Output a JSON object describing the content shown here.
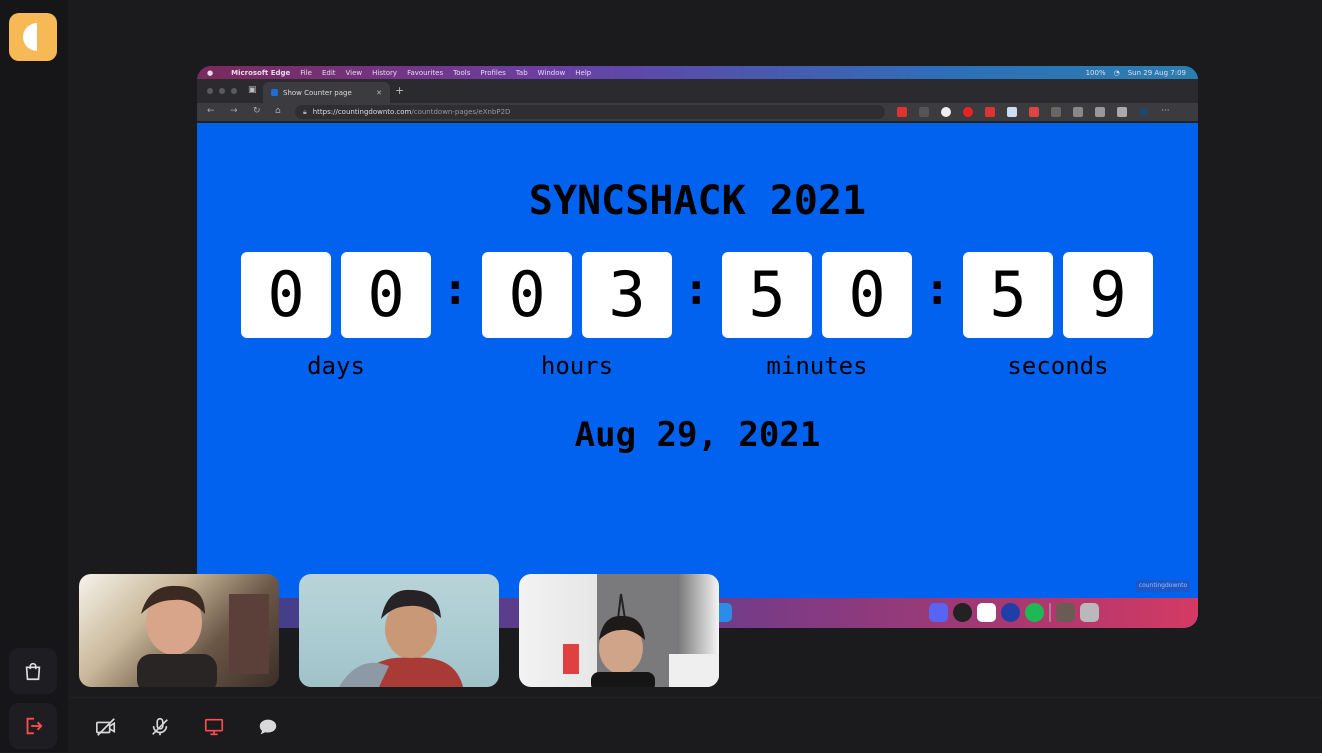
{
  "sidebar": {
    "logo": "app-logo",
    "icons": [
      "shopping-bag-icon",
      "leave-icon"
    ]
  },
  "browser": {
    "menubar": {
      "app": "Microsoft Edge",
      "items": [
        "File",
        "Edit",
        "View",
        "History",
        "Favourites",
        "Tools",
        "Profiles",
        "Tab",
        "Window",
        "Help"
      ],
      "battery": "100%",
      "clock": "Sun 29 Aug 7:09"
    },
    "tab_title": "Show Counter page",
    "url_host": "https://countingdownto.com",
    "url_path": "/countdown-pages/eXnbP2D"
  },
  "countdown": {
    "title": "SYNCSHACK 2021",
    "digits": [
      "0",
      "0",
      "0",
      "3",
      "5",
      "0",
      "5",
      "9"
    ],
    "separator": ":",
    "labels": [
      "days",
      "hours",
      "minutes",
      "seconds"
    ],
    "date": "Aug 29, 2021",
    "badge": "countingdownto"
  },
  "participants": [
    "participant-1",
    "participant-2",
    "participant-3"
  ],
  "controls": [
    "camera-off-icon",
    "mic-off-icon",
    "screen-share-icon",
    "chat-icon"
  ],
  "colors": {
    "page_bg": "#1b1b1e",
    "logo": "#f7b955",
    "countdown_bg": "#0062ee",
    "leave": "#ff4d4d",
    "share_active": "#ff4d4d"
  }
}
